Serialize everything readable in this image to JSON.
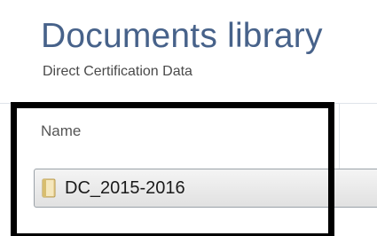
{
  "library": {
    "title": "Documents library",
    "subtitle": "Direct Certification Data"
  },
  "columns": {
    "name_header": "Name"
  },
  "items": [
    {
      "name": "DC_2015-2016",
      "icon": "folder-icon"
    }
  ],
  "annotation": {
    "highlight_color": "#000000"
  }
}
